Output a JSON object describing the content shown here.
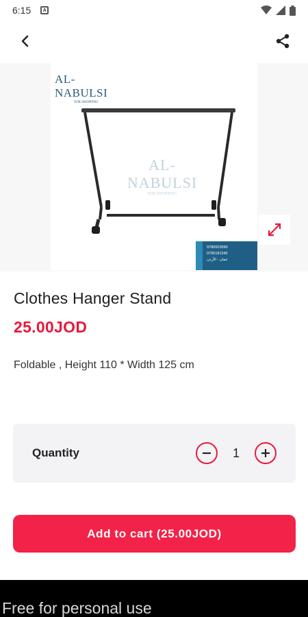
{
  "status_bar": {
    "time": "6:15",
    "notification_icon": "A"
  },
  "app_bar": {
    "back_icon": "chevron-left-icon",
    "share_icon": "share-icon"
  },
  "product_image": {
    "logo_text": "AL-NABULSI",
    "logo_subtext": "FOR SHOPPING",
    "watermark_text": "AL-NABULSI",
    "watermark_subtext": "FOR SHOPPING",
    "contact_lines": [
      "0780002890",
      "0795181345",
      "عمان - الأردن"
    ]
  },
  "product": {
    "title": "Clothes Hanger Stand",
    "price": "25.00JOD",
    "description": "Foldable , Height 110 * Width 125 cm"
  },
  "quantity": {
    "label": "Quantity",
    "value": "1"
  },
  "add_to_cart": {
    "label": "Add to cart (25.00JOD)"
  },
  "footer": {
    "text": "Free for personal use"
  },
  "colors": {
    "accent": "#f32248",
    "price": "#e6193c"
  }
}
